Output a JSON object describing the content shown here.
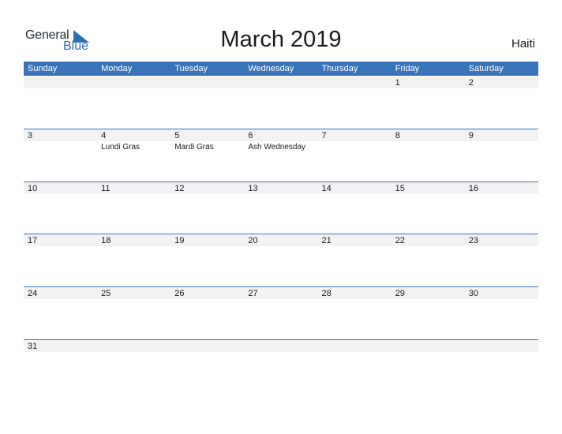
{
  "brand": {
    "general": "General",
    "blue": "Blue",
    "mark_color": "#2f6db5"
  },
  "title": "March 2019",
  "country": "Haiti",
  "weekdays": [
    "Sunday",
    "Monday",
    "Tuesday",
    "Wednesday",
    "Thursday",
    "Friday",
    "Saturday"
  ],
  "colors": {
    "header_bg": "#3a74b8",
    "band_bg": "#f2f2f2"
  },
  "weeks": [
    [
      {
        "d": ""
      },
      {
        "d": ""
      },
      {
        "d": ""
      },
      {
        "d": ""
      },
      {
        "d": ""
      },
      {
        "d": "1"
      },
      {
        "d": "2"
      }
    ],
    [
      {
        "d": "3"
      },
      {
        "d": "4",
        "e": "Lundi Gras"
      },
      {
        "d": "5",
        "e": "Mardi Gras"
      },
      {
        "d": "6",
        "e": "Ash Wednesday"
      },
      {
        "d": "7"
      },
      {
        "d": "8"
      },
      {
        "d": "9"
      }
    ],
    [
      {
        "d": "10"
      },
      {
        "d": "11"
      },
      {
        "d": "12"
      },
      {
        "d": "13"
      },
      {
        "d": "14"
      },
      {
        "d": "15"
      },
      {
        "d": "16"
      }
    ],
    [
      {
        "d": "17"
      },
      {
        "d": "18"
      },
      {
        "d": "19"
      },
      {
        "d": "20"
      },
      {
        "d": "21"
      },
      {
        "d": "22"
      },
      {
        "d": "23"
      }
    ],
    [
      {
        "d": "24"
      },
      {
        "d": "25"
      },
      {
        "d": "26"
      },
      {
        "d": "27"
      },
      {
        "d": "28"
      },
      {
        "d": "29"
      },
      {
        "d": "30"
      }
    ],
    [
      {
        "d": "31"
      },
      {
        "d": ""
      },
      {
        "d": ""
      },
      {
        "d": ""
      },
      {
        "d": ""
      },
      {
        "d": ""
      },
      {
        "d": ""
      }
    ]
  ]
}
